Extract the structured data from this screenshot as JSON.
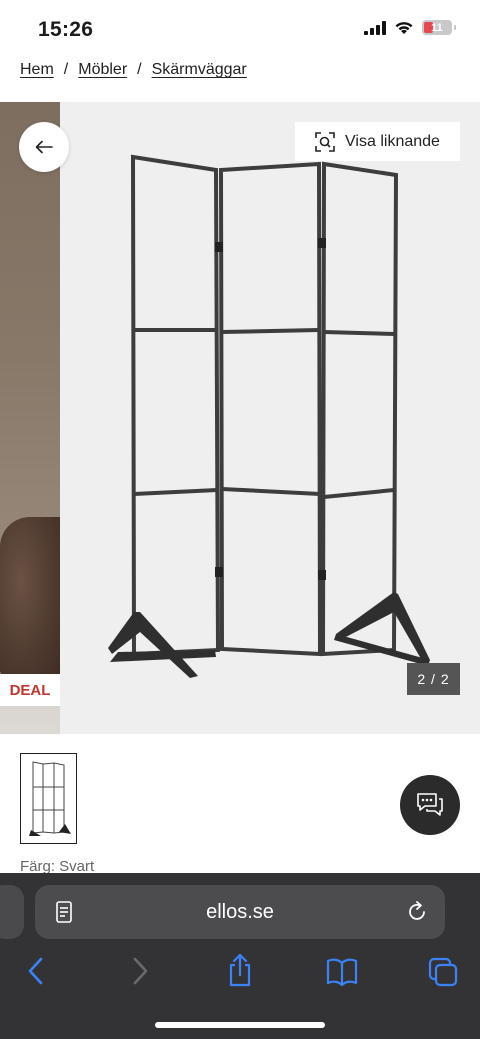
{
  "status": {
    "time": "15:26",
    "battery": "11",
    "battery_color": "#e5484d"
  },
  "breadcrumb": [
    "Hem",
    "Möbler",
    "Skärmväggar"
  ],
  "gallery": {
    "similar_label": "Visa liknande",
    "deal_label": "DEAL",
    "pager": "2 / 2",
    "deal_color": "#c0362c"
  },
  "product": {
    "color_label": "Färg: Svart"
  },
  "browser": {
    "url": "ellos.se",
    "accent": "#3b82f6"
  },
  "icons": [
    "signal-icon",
    "wifi-icon",
    "battery-icon",
    "back-arrow-icon",
    "visual-search-icon",
    "chat-icon",
    "reader-icon",
    "reload-icon",
    "back-icon",
    "forward-icon",
    "share-icon",
    "bookmarks-icon",
    "tabs-icon"
  ]
}
